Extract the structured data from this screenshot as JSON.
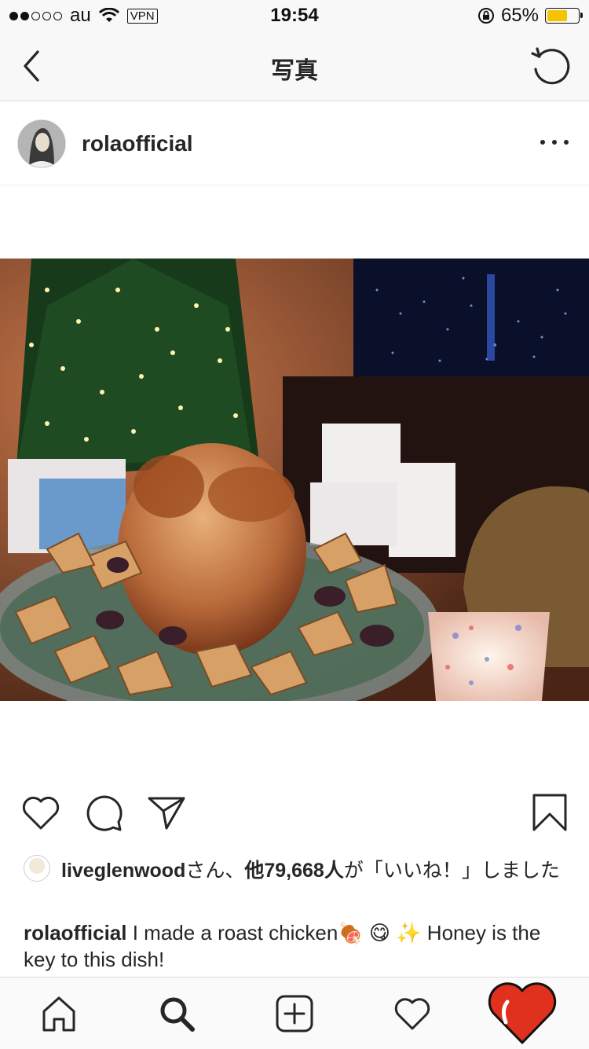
{
  "status_bar": {
    "carrier": "au",
    "vpn": "VPN",
    "time": "19:54",
    "battery_percent": "65%",
    "battery_level": 0.65,
    "battery_color": "#f5c400"
  },
  "nav": {
    "title": "写真",
    "back_icon": "chevron-left-icon",
    "refresh_icon": "refresh-icon"
  },
  "post": {
    "username": "rolaofficial",
    "more_icon": "more-horizontal-icon",
    "photo_subject": "roast chicken on a platter in front of a Christmas tree"
  },
  "likes": {
    "liker": "liveglenwood",
    "san": "さん、",
    "others": "他79,668人",
    "suffix": "が「いいね！」しました"
  },
  "caption": {
    "username": "rolaofficial",
    "text": " I made a roast chicken🍖 😋 ✨ Honey is the key to this dish!"
  },
  "tabbar": {
    "items": [
      "home-icon",
      "search-icon",
      "add-post-icon",
      "activity-heart-icon",
      "profile-heart-icon"
    ]
  },
  "colors": {
    "accent_heart": "#e0301e",
    "text": "#262626"
  }
}
